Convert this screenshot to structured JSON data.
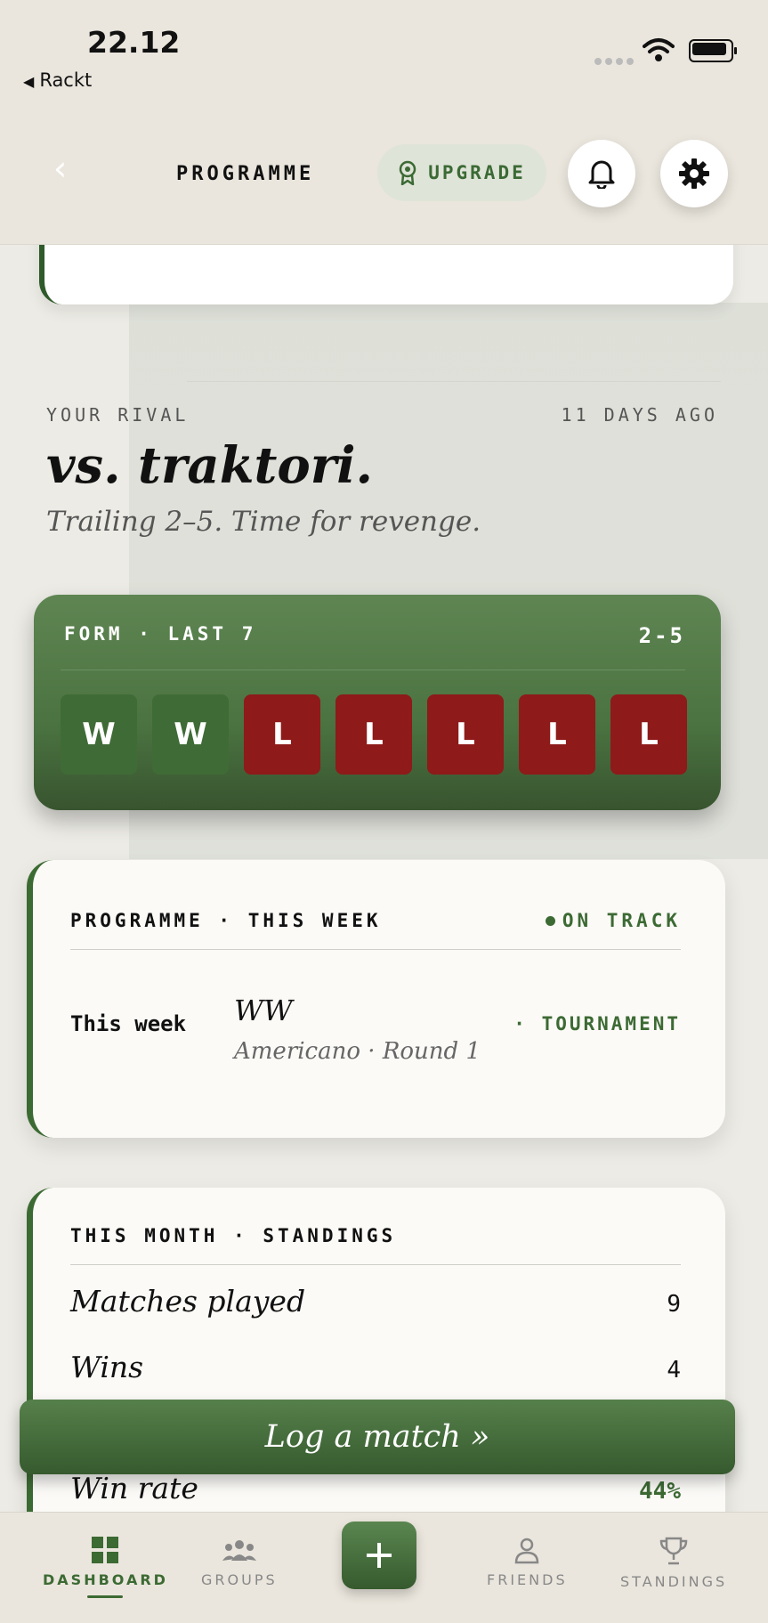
{
  "status_bar": {
    "time": "22.12",
    "back_app": "Rackt"
  },
  "header": {
    "title": "PROGRAMME",
    "upgrade_label": "UPGRADE"
  },
  "rival": {
    "kicker": "YOUR RIVAL",
    "ago": "11 DAYS AGO",
    "title": "vs. traktori.",
    "subtitle": "Trailing 2–5. Time for revenge."
  },
  "form": {
    "label": "FORM · LAST 7",
    "score": "2-5",
    "results": [
      "W",
      "W",
      "L",
      "L",
      "L",
      "L",
      "L"
    ]
  },
  "programme": {
    "kicker": "PROGRAMME · THIS WEEK",
    "status": "ON TRACK",
    "week_label": "This week",
    "result": "WW",
    "detail": "Americano · Round 1",
    "tag": "· TOURNAMENT"
  },
  "standings": {
    "kicker": "THIS MONTH · STANDINGS",
    "rows": [
      {
        "label": "Matches played",
        "value": "9"
      },
      {
        "label": "Wins",
        "value": "4"
      },
      {
        "label": "Win rate",
        "value": "44%"
      }
    ]
  },
  "log_button": "Log a match »",
  "tabs": [
    {
      "label": "DASHBOARD",
      "icon": "grid-icon",
      "active": true
    },
    {
      "label": "GROUPS",
      "icon": "group-icon",
      "active": false
    },
    {
      "label": "FRIENDS",
      "icon": "person-icon",
      "active": false
    },
    {
      "label": "STANDINGS",
      "icon": "trophy-icon",
      "active": false
    }
  ],
  "colors": {
    "accent": "#3c6a33",
    "win": "#3f6b36",
    "loss": "#8e1a1a"
  }
}
